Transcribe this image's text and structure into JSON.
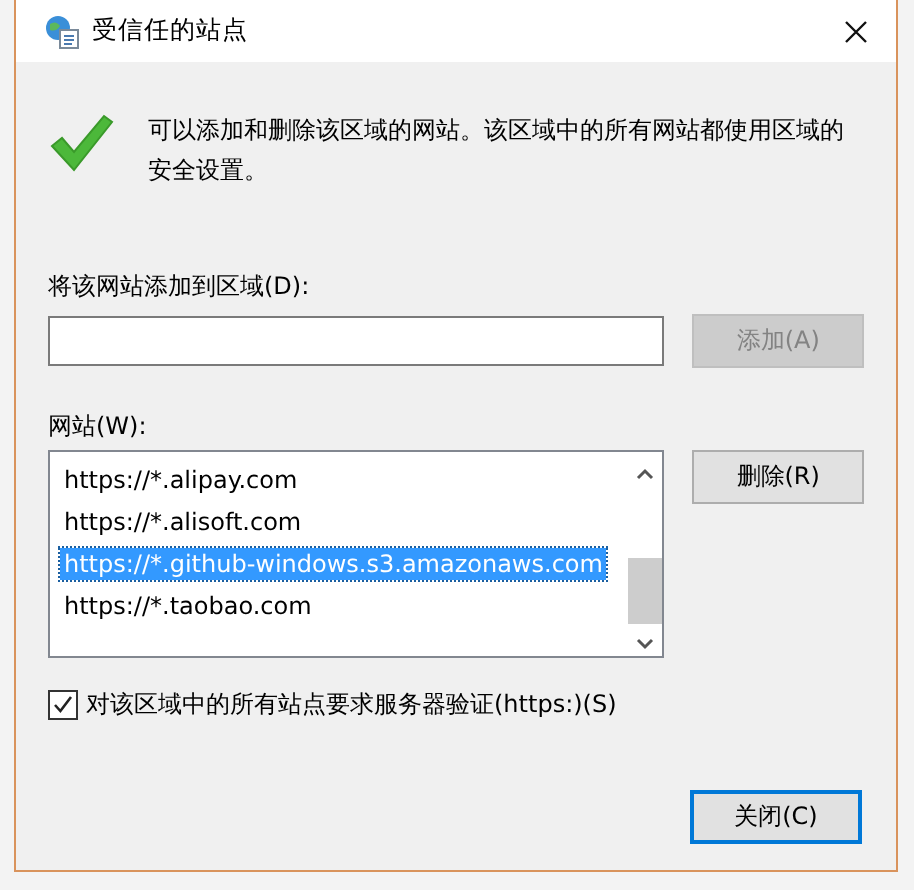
{
  "window": {
    "title": "受信任的站点"
  },
  "message": "可以添加和删除该区域的网站。该区域中的所有网站都使用区域的安全设置。",
  "add_section": {
    "label": "将该网站添加到区域(D):",
    "add_button": {
      "label": "添加(A)",
      "disabled": true
    }
  },
  "sites_section": {
    "label": "网站(W):",
    "sites": [
      {
        "url": "https://*.alipay.com",
        "selected": false
      },
      {
        "url": "https://*.alisoft.com",
        "selected": false
      },
      {
        "url": "https://*.github-windows.s3.amazonaws.com",
        "selected": true
      },
      {
        "url": "https://*.taobao.com",
        "selected": false
      }
    ],
    "remove_button": "删除(R)"
  },
  "require_https": {
    "label": "对该区域中的所有站点要求服务器验证(https:)(S)",
    "checked": true
  },
  "close_button": "关闭(C)"
}
